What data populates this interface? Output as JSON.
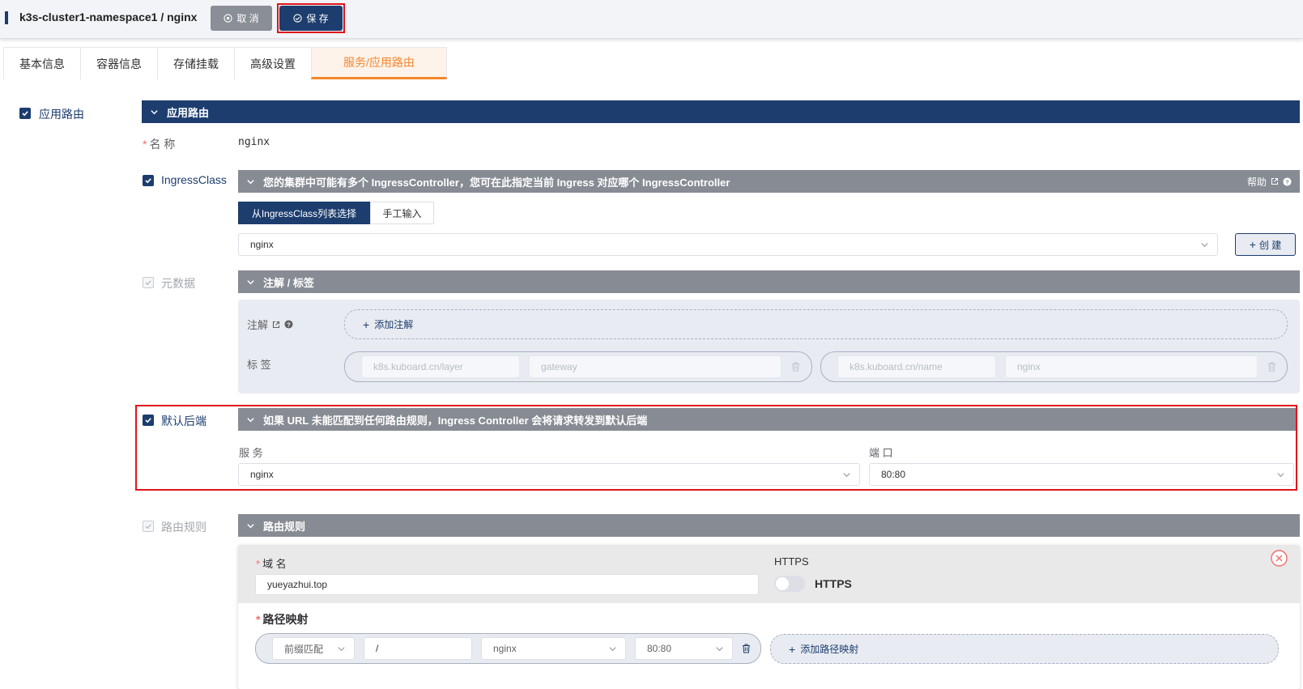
{
  "header": {
    "title": "k3s-cluster1-namespace1 / nginx",
    "cancel_label": "取 消",
    "save_label": "保 存"
  },
  "tabs": [
    {
      "label": "基本信息"
    },
    {
      "label": "容器信息"
    },
    {
      "label": "存储挂载"
    },
    {
      "label": "高级设置"
    },
    {
      "label": "服务/应用路由",
      "active": true
    }
  ],
  "ingress": {
    "checkbox_label": "应用路由",
    "section_title": "应用路由",
    "name_label": "名 称",
    "name_value": "nginx",
    "ingress_class": {
      "checkbox_label": "IngressClass",
      "bar_text": "您的集群中可能有多个 IngressController，您可在此指定当前 Ingress 对应哪个 IngressController",
      "help_label": "帮助",
      "mode_options": [
        "从IngressClass列表选择",
        "手工输入"
      ],
      "selected_value": "nginx",
      "create_label": "创 建"
    },
    "metadata": {
      "checkbox_label": "元数据",
      "bar_text": "注解 / 标签",
      "annotation_label": "注解",
      "add_annotation_label": "添加注解",
      "labels_label": "标 签",
      "labels": [
        {
          "key": "k8s.kuboard.cn/layer",
          "value": "gateway"
        },
        {
          "key": "k8s.kuboard.cn/name",
          "value": "nginx"
        }
      ]
    },
    "default_backend": {
      "checkbox_label": "默认后端",
      "bar_text": "如果 URL 未能匹配到任何路由规则，Ingress Controller 会将请求转发到默认后端",
      "service_label": "服 务",
      "service_value": "nginx",
      "port_label": "端 口",
      "port_value": "80:80"
    },
    "rules": {
      "checkbox_label": "路由规则",
      "bar_text": "路由规则",
      "domain_label": "域 名",
      "domain_value": "yueyazhui.top",
      "https_header": "HTTPS",
      "https_toggle_label": "HTTPS",
      "https_enabled": false,
      "path_mapping_label": "路径映射",
      "path": {
        "match_type": "前缀匹配",
        "path_value": "/",
        "service": "nginx",
        "port": "80:80"
      },
      "add_path_label": "添加路径映射"
    }
  },
  "colors": {
    "brand": "#1c3d6e",
    "accent": "#f5862d",
    "highlight": "#e0141a",
    "bar_gray": "#878b93"
  }
}
